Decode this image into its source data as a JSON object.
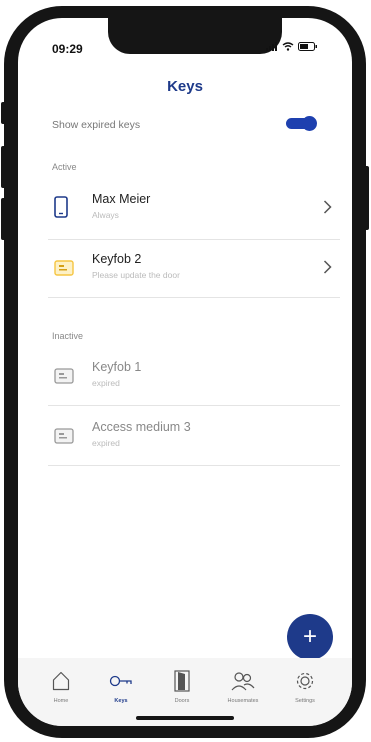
{
  "status": {
    "time": "09:29"
  },
  "header": {
    "title": "Keys"
  },
  "settings": {
    "show_expired_label": "Show expired keys",
    "show_expired_on": true
  },
  "sections": {
    "active_label": "Active",
    "inactive_label": "Inactive"
  },
  "active_keys": [
    {
      "name": "Max Meier",
      "sub": "Always",
      "icon": "phone-icon"
    },
    {
      "name": "Keyfob 2",
      "sub": "Please update the door",
      "icon": "keyfob-icon"
    }
  ],
  "inactive_keys": [
    {
      "name": "Keyfob 1",
      "sub": "expired",
      "icon": "keyfob-icon"
    },
    {
      "name": "Access medium 3",
      "sub": "expired",
      "icon": "keyfob-icon"
    }
  ],
  "fab": {
    "label": "+"
  },
  "tabs": [
    {
      "label": "Home",
      "icon": "house-icon",
      "active": false
    },
    {
      "label": "Keys",
      "icon": "key-icon",
      "active": true
    },
    {
      "label": "Doors",
      "icon": "door-icon",
      "active": false
    },
    {
      "label": "Housemates",
      "icon": "people-icon",
      "active": false
    },
    {
      "label": "Settings",
      "icon": "gear-icon",
      "active": false
    }
  ],
  "colors": {
    "accent": "#1e3a8a",
    "keyfob_active": "#f5c542"
  }
}
